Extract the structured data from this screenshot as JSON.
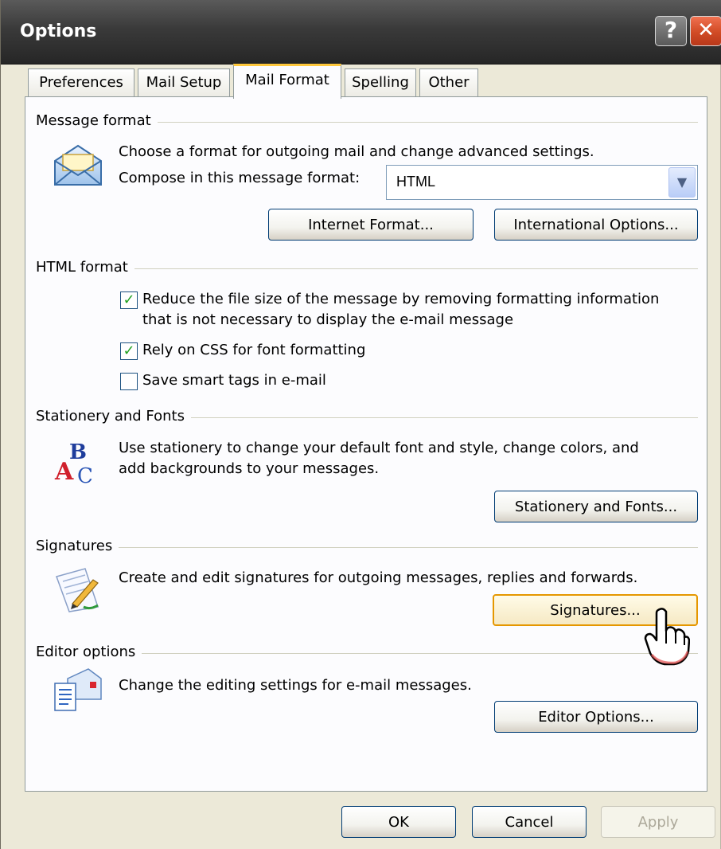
{
  "window": {
    "title": "Options",
    "help_label": "?",
    "close_label": "✕"
  },
  "tabs": [
    {
      "label": "Preferences",
      "active": false
    },
    {
      "label": "Mail Setup",
      "active": false
    },
    {
      "label": "Mail Format",
      "active": true
    },
    {
      "label": "Spelling",
      "active": false
    },
    {
      "label": "Other",
      "active": false
    }
  ],
  "message_format": {
    "header": "Message format",
    "icon": "envelope-icon",
    "description": "Choose a format for outgoing mail and change advanced settings.",
    "compose_label": "Compose in this message format:",
    "compose_value": "HTML",
    "internet_format_button": "Internet Format...",
    "international_options_button": "International Options..."
  },
  "html_format": {
    "header": "HTML format",
    "options": [
      {
        "label_line1": "Reduce the file size of the message by removing formatting information",
        "label_line2": "that is not necessary to display the e-mail message",
        "checked": true
      },
      {
        "label_line1": "Rely on CSS for font formatting",
        "checked": true
      },
      {
        "label_line1": "Save smart tags in e-mail",
        "checked": false
      }
    ]
  },
  "stationery": {
    "header": "Stationery and Fonts",
    "icon": "stationery-abc-icon",
    "line1": "Use stationery to change your default font and style, change colors, and",
    "line2": "add backgrounds to your messages.",
    "button": "Stationery and Fonts..."
  },
  "signatures": {
    "header": "Signatures",
    "icon": "signature-pen-icon",
    "description": "Create and edit signatures for outgoing messages, replies and forwards.",
    "button": "Signatures..."
  },
  "editor": {
    "header": "Editor options",
    "icon": "editor-document-icon",
    "description": "Change the editing settings for e-mail messages.",
    "button": "Editor Options..."
  },
  "footer": {
    "ok": "OK",
    "cancel": "Cancel",
    "apply": "Apply"
  },
  "colors": {
    "titlebar": "#3a3a3a",
    "dialog_bg": "#ece9d8",
    "panel_bg": "#fcfcfe",
    "active_tab_accent": "#ffc83c",
    "hover_button_border": "#e59700"
  }
}
